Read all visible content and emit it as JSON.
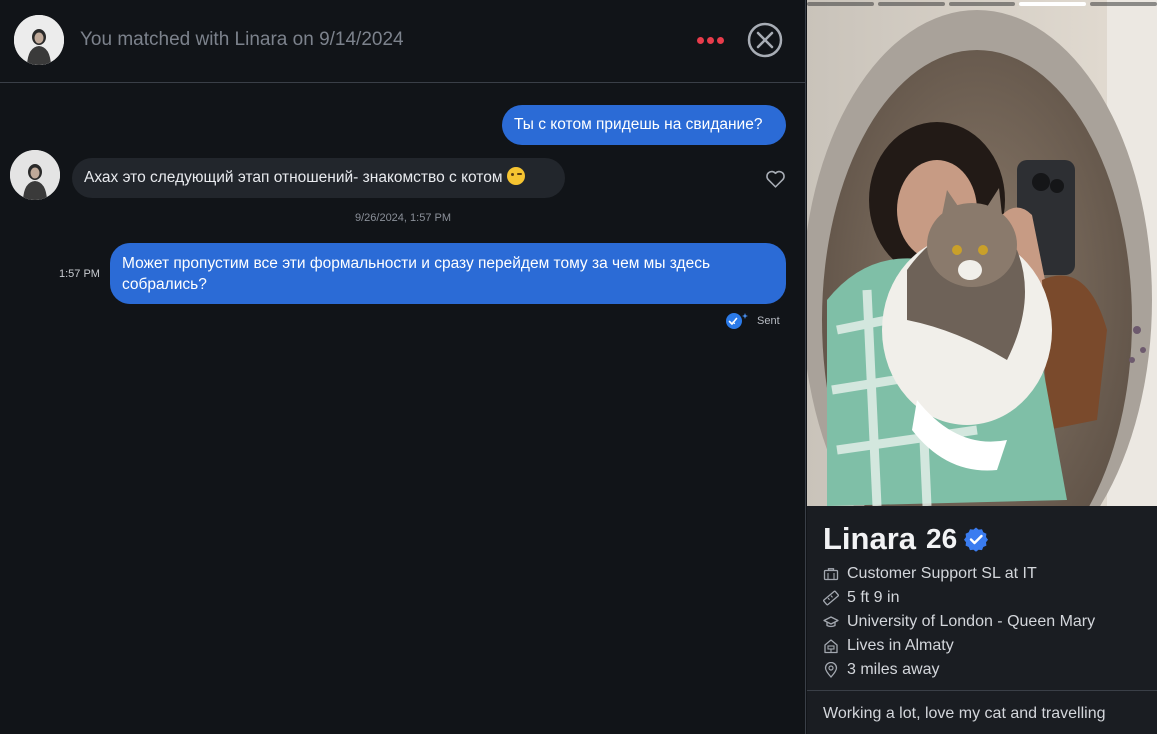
{
  "header": {
    "match_text": "You matched with Linara on 9/14/2024"
  },
  "messages": [
    {
      "direction": "outgoing",
      "text": "Ты с котом придешь на свидание?"
    },
    {
      "direction": "incoming",
      "text": "Ахах это следующий этап отношений- знакомство с котом",
      "emoji": "winking-face"
    },
    {
      "direction": "outgoing",
      "text": "Может пропустим все эти формальности и сразу перейдем тому за чем мы здесь собрались?",
      "time": "1:57 PM",
      "status": "Sent"
    }
  ],
  "timestamp_divider": "9/26/2024, 1:57 PM",
  "colors": {
    "accent": "#2b6bd6",
    "dots": "#e83c4b",
    "background": "#111418",
    "incoming_bubble": "#22262c"
  },
  "profile": {
    "name": "Linara",
    "age": "26",
    "verified": true,
    "photo_count": 5,
    "active_photo_index": 3,
    "details": [
      {
        "icon": "briefcase-icon",
        "text": "Customer Support SL at IT"
      },
      {
        "icon": "ruler-icon",
        "text": "5 ft 9 in"
      },
      {
        "icon": "graduation-cap-icon",
        "text": "University of London - Queen Mary"
      },
      {
        "icon": "home-icon",
        "text": "Lives in Almaty"
      },
      {
        "icon": "location-pin-icon",
        "text": "3 miles away"
      }
    ],
    "bio": "Working a lot, love my cat and travelling"
  }
}
